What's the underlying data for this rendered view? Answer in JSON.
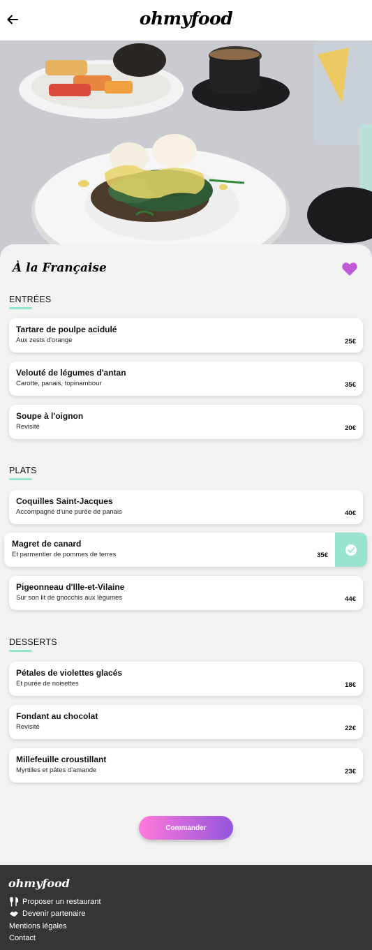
{
  "header": {
    "logo": "ohmyfood",
    "back_icon": "arrow-left-icon"
  },
  "restaurant": {
    "name": "À la Française",
    "favorite_icon": "heart-icon",
    "favorite_color": "#c15ad8"
  },
  "sections": {
    "entrees": {
      "title": "ENTRÉES",
      "dishes": [
        {
          "name": "Tartare de poulpe acidulé",
          "desc": "Aux zests d'orange",
          "price": "25€"
        },
        {
          "name": "Velouté de légumes d'antan",
          "desc": "Carotte, panais, topinambour",
          "price": "35€"
        },
        {
          "name": "Soupe à l'oignon",
          "desc": "Revisité",
          "price": "20€"
        }
      ]
    },
    "plats": {
      "title": "PLATS",
      "dishes": [
        {
          "name": "Coquilles Saint-Jacques",
          "desc": "Accompagné d'une purée de panais",
          "price": "40€"
        },
        {
          "name": "Magret de canard",
          "desc": "Et parmentier de pommes de terres",
          "price": "35€",
          "selected": true
        },
        {
          "name": "Pigeonneau d'Ille-et-Vilaine",
          "desc": "Sur son lit de gnocchis aux légumes",
          "price": "44€"
        }
      ]
    },
    "desserts": {
      "title": "DESSERTS",
      "dishes": [
        {
          "name": "Pétales de violettes glacés",
          "desc": "Et purée de noisettes",
          "price": "18€"
        },
        {
          "name": "Fondant au chocolat",
          "desc": "Revisité",
          "price": "22€"
        },
        {
          "name": "Millefeuille croustillant",
          "desc": "Myrtilles et pâtes d'amande",
          "price": "23€"
        }
      ]
    }
  },
  "order": {
    "label": "Commander"
  },
  "footer": {
    "logo": "ohmyfood",
    "links": [
      {
        "label": "Proposer un restaurant",
        "icon": "utensils-icon"
      },
      {
        "label": "Devenir partenaire",
        "icon": "handshake-icon"
      },
      {
        "label": "Mentions légales"
      },
      {
        "label": "Contact"
      }
    ]
  },
  "colors": {
    "accent": "#99e2d0",
    "button_start": "#ff79da",
    "button_end": "#9356dc",
    "footer_bg": "#353535"
  }
}
